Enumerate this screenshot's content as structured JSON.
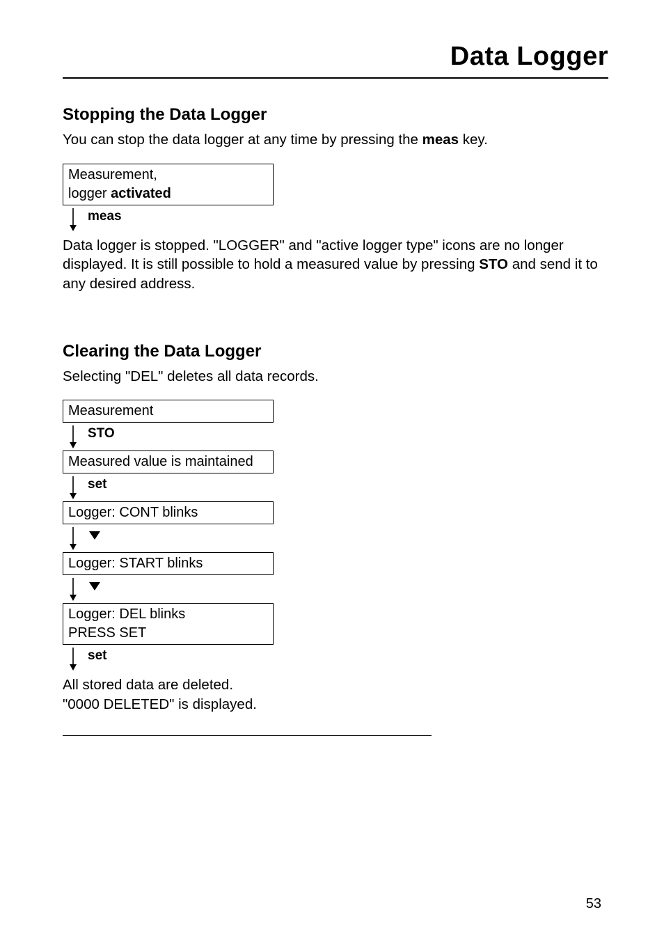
{
  "header": {
    "title": "Data Logger"
  },
  "s1": {
    "heading": "Stopping the Data Logger",
    "intro_pre": "You can stop the data logger at any time by pressing the ",
    "intro_bold": "meas",
    "intro_post": " key.",
    "box1_l1": "Measurement,",
    "box1_l2_pre": "logger ",
    "box1_l2_bold": "activated",
    "step1": "meas",
    "result_pre": "Data logger is stopped. \"LOGGER\" and \"active logger type\" icons are no longer displayed. It is still possible to hold a measured value by pressing ",
    "result_bold": "STO",
    "result_post": " and send it to any desired address."
  },
  "s2": {
    "heading": "Clearing the Data Logger",
    "intro": "Selecting \"DEL\" deletes all data records.",
    "box1": "Measurement",
    "step1": "STO",
    "box2": "Measured value is maintained",
    "step2": "set",
    "box3": "Logger: CONT blinks",
    "box4": "Logger: START blinks",
    "box5_l1": "Logger: DEL blinks",
    "box5_l2": "PRESS SET",
    "step3": "set",
    "result_l1": "All stored data are deleted.",
    "result_l2": "\"0000 DELETED\" is displayed."
  },
  "page_number": "53"
}
